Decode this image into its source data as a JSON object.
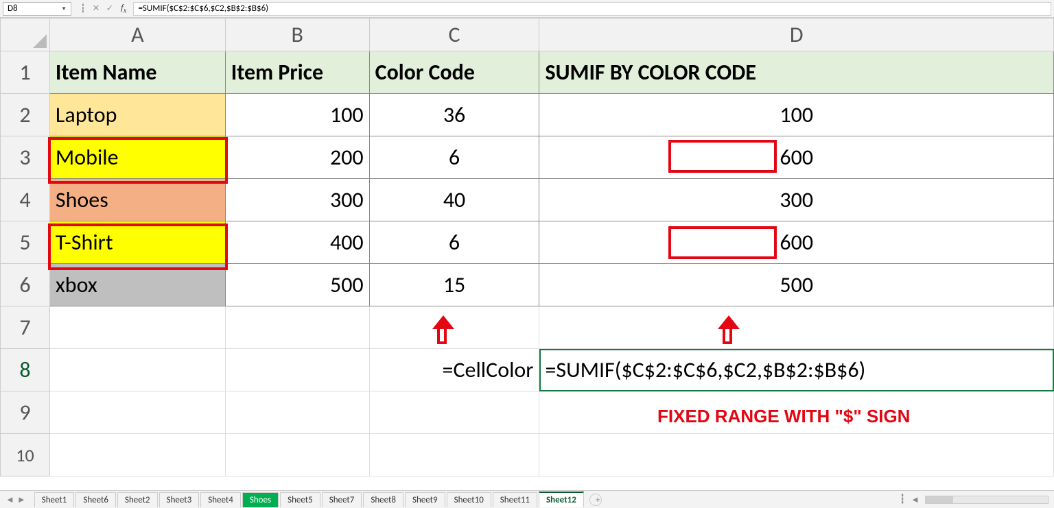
{
  "formula_bar": {
    "name_box": "D8",
    "formula": "=SUMIF($C$2:$C$6,$C2,$B$2:$B$6)"
  },
  "columns": [
    "A",
    "B",
    "C",
    "D"
  ],
  "rows": [
    "1",
    "2",
    "3",
    "4",
    "5",
    "6",
    "7",
    "8",
    "9",
    "10"
  ],
  "headers": {
    "A": "Item Name",
    "B": "Item Price",
    "C": "Color Code",
    "D": "SUMIF BY COLOR CODE"
  },
  "r2": {
    "A": "Laptop",
    "B": "100",
    "C": "36",
    "D": "100"
  },
  "r3": {
    "A": "Mobile",
    "B": "200",
    "C": "6",
    "D": "600"
  },
  "r4": {
    "A": "Shoes",
    "B": "300",
    "C": "40",
    "D": "300"
  },
  "r5": {
    "A": "T-Shirt",
    "B": "400",
    "C": "6",
    "D": "600"
  },
  "r6": {
    "A": "xbox",
    "B": "500",
    "C": "15",
    "D": "500"
  },
  "r8": {
    "C": "=CellColor",
    "D": "=SUMIF($C$2:$C$6,$C2,$B$2:$B$6)"
  },
  "annot_text": "FIXED RANGE WITH \"$\" SIGN",
  "tabs": {
    "t0": "Sheet1",
    "t1": "Sheet6",
    "t2": "Sheet2",
    "t3": "Sheet3",
    "t4": "Sheet4",
    "t5": "Shoes",
    "t6": "Sheet5",
    "t7": "Sheet7",
    "t8": "Sheet8",
    "t9": "Sheet9",
    "t10": "Sheet10",
    "t11": "Sheet11",
    "t12": "Sheet12"
  },
  "chart_data": {
    "type": "table",
    "title": "SUMIF BY COLOR CODE example",
    "columns": [
      "Item Name",
      "Item Price",
      "Color Code",
      "SUMIF BY COLOR CODE"
    ],
    "rows": [
      [
        "Laptop",
        100,
        36,
        100
      ],
      [
        "Mobile",
        200,
        6,
        600
      ],
      [
        "Shoes",
        300,
        40,
        300
      ],
      [
        "T-Shirt",
        400,
        6,
        600
      ],
      [
        "xbox",
        500,
        15,
        500
      ]
    ],
    "formulas": {
      "C8": "=CellColor",
      "D8": "=SUMIF($C$2:$C$6,$C2,$B$2:$B$6)"
    }
  }
}
